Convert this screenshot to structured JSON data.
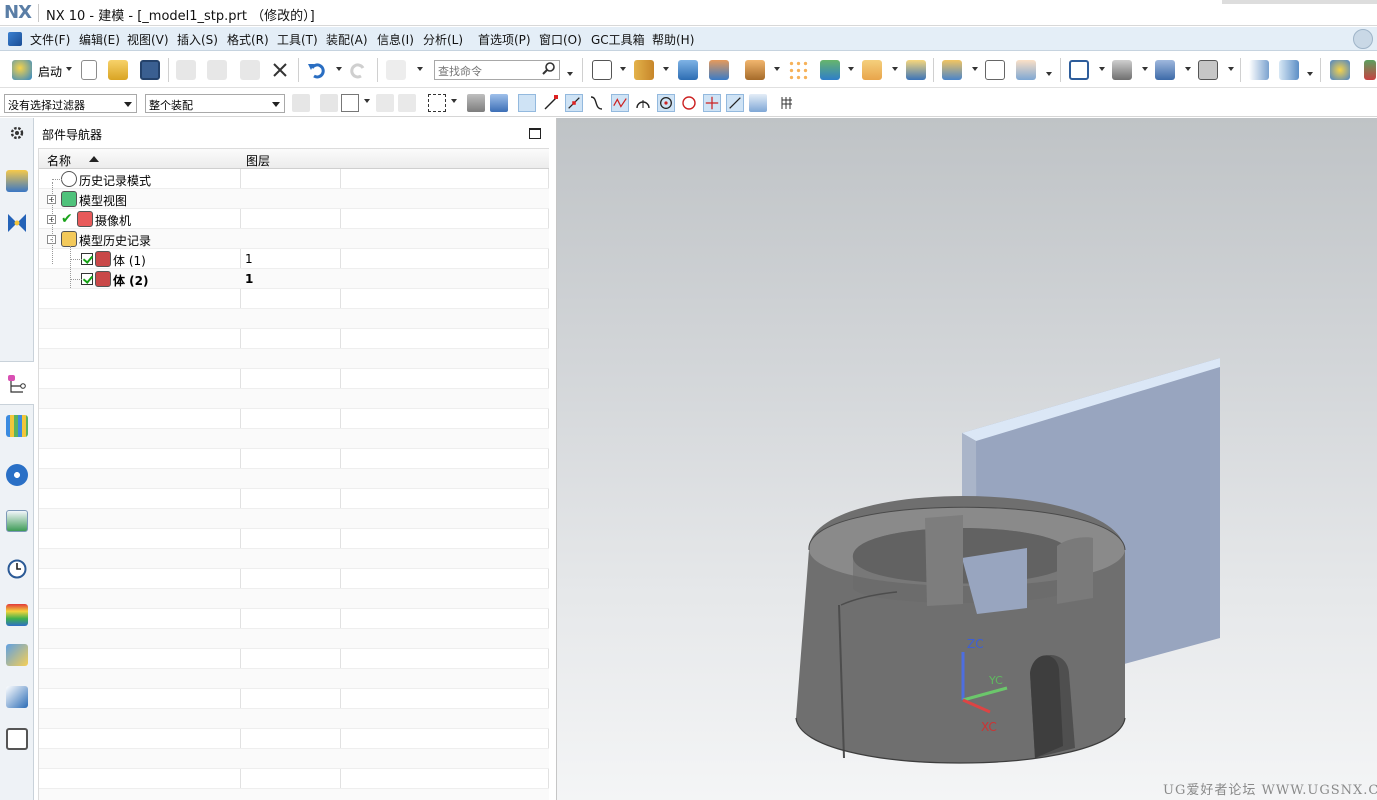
{
  "titlebar": {
    "logo": "NX",
    "title": "NX 10 - 建模 - [_model1_stp.prt （修改的）]"
  },
  "menubar": {
    "items": [
      {
        "label": "文件(F)"
      },
      {
        "label": "编辑(E)"
      },
      {
        "label": "视图(V)"
      },
      {
        "label": "插入(S)"
      },
      {
        "label": "格式(R)"
      },
      {
        "label": "工具(T)"
      },
      {
        "label": "装配(A)"
      },
      {
        "label": "信息(I)"
      },
      {
        "label": "分析(L)"
      },
      {
        "label": "首选项(P)"
      },
      {
        "label": "窗口(O)"
      },
      {
        "label": "GC工具箱"
      },
      {
        "label": "帮助(H)"
      }
    ]
  },
  "toolbar": {
    "start_label": "启动",
    "command_search_placeholder": "查找命令"
  },
  "selection_bar": {
    "filter_value": "没有选择过滤器",
    "scope_value": "整个装配"
  },
  "navigator": {
    "title": "部件导航器",
    "columns": [
      "名称",
      "图层"
    ],
    "rows": [
      {
        "label": "历史记录模式",
        "layer": "",
        "icon": "clock-icon",
        "expander": ""
      },
      {
        "label": "模型视图",
        "layer": "",
        "icon": "model-views-icon",
        "expander": "+"
      },
      {
        "label": "摄像机",
        "layer": "",
        "icon": "camera-icon",
        "expander": "+"
      },
      {
        "label": "模型历史记录",
        "layer": "",
        "icon": "folder-icon",
        "expander": "-"
      },
      {
        "label": "体 (1)",
        "layer": "1",
        "icon": "body-feature-icon",
        "checked": true
      },
      {
        "label": "体 (2)",
        "layer": "1",
        "icon": "body-feature-icon",
        "checked": true,
        "bold": true
      }
    ]
  },
  "viewport": {
    "csys": {
      "z": "ZC",
      "y": "YC",
      "x": "XC"
    },
    "watermark": "UG爱好者论坛 WWW.UGSNX.COM",
    "colors": {
      "plate": "#98a5bf",
      "part": "#6f6f6f",
      "background_top": "#bfc3c6",
      "background_bottom": "#f4f5f6"
    }
  }
}
